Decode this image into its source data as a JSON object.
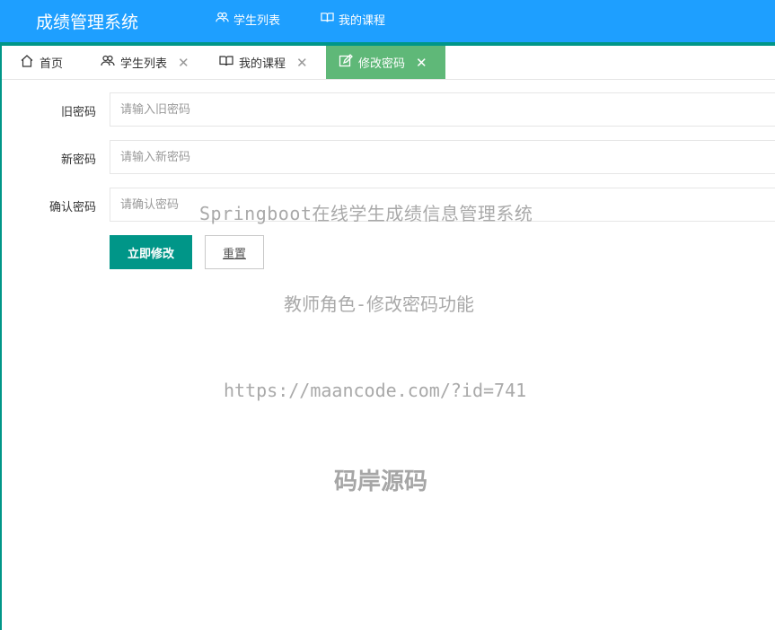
{
  "header": {
    "logo": "成绩管理系统",
    "nav": [
      {
        "label": "学生列表",
        "icon": "users-icon"
      },
      {
        "label": "我的课程",
        "icon": "book-icon"
      }
    ]
  },
  "tabs": [
    {
      "label": "首页",
      "icon": "home-icon",
      "closable": false
    },
    {
      "label": "学生列表",
      "icon": "users-icon",
      "closable": true
    },
    {
      "label": "我的课程",
      "icon": "book-icon",
      "closable": true
    },
    {
      "label": "修改密码",
      "icon": "edit-icon",
      "closable": true,
      "active": true
    }
  ],
  "tab_close_glyph": "✕",
  "form": {
    "old_password": {
      "label": "旧密码",
      "placeholder": "请输入旧密码"
    },
    "new_password": {
      "label": "新密码",
      "placeholder": "请输入新密码"
    },
    "confirm_password": {
      "label": "确认密码",
      "placeholder": "请确认密码"
    },
    "submit_label": "立即修改",
    "reset_label": "重置"
  },
  "watermark": {
    "line1": "Springboot在线学生成绩信息管理系统",
    "line2": "教师角色-修改密码功能",
    "line3": "https://maancode.com/?id=741",
    "line4": "码岸源码"
  },
  "colors": {
    "header": "#1e9fff",
    "accent": "#009688",
    "active_tab": "#5fb878"
  }
}
